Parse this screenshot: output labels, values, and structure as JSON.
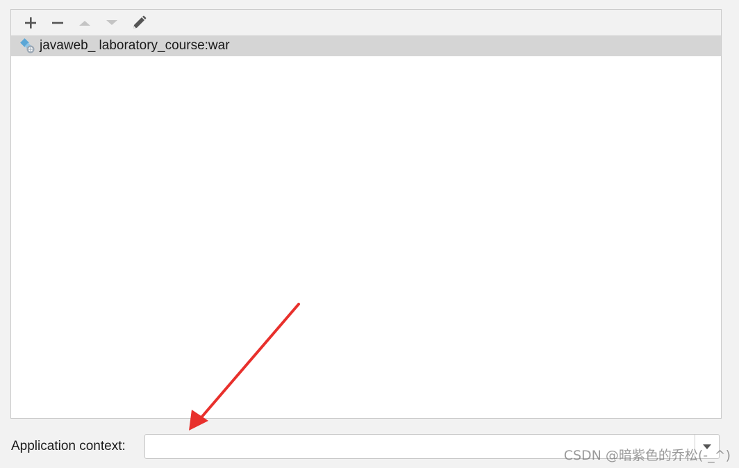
{
  "toolbar": {
    "buttons": [
      {
        "name": "add-icon",
        "enabled": true
      },
      {
        "name": "remove-icon",
        "enabled": true
      },
      {
        "name": "move-up-icon",
        "enabled": false
      },
      {
        "name": "move-down-icon",
        "enabled": false
      },
      {
        "name": "edit-icon",
        "enabled": true
      }
    ]
  },
  "list": {
    "items": [
      {
        "label": "javaweb_ laboratory_course:war",
        "icon": "war-artifact-icon",
        "selected": true
      }
    ]
  },
  "context": {
    "label": "Application context:",
    "value": "",
    "placeholder": ""
  },
  "watermark": "CSDN @暗紫色的乔松(-_^)",
  "colors": {
    "accent_arrow": "#e8302c",
    "selection": "#d5d5d5",
    "background": "#f2f2f2"
  }
}
